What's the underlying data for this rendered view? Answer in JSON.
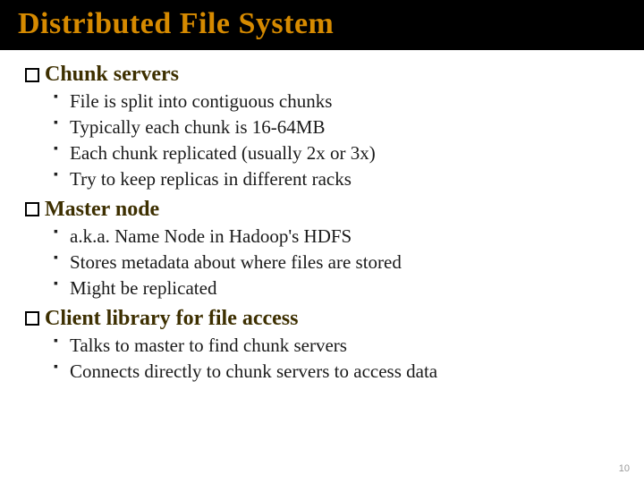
{
  "title": "Distributed File System",
  "sections": [
    {
      "heading": "Chunk servers",
      "items": [
        "File is split into contiguous chunks",
        "Typically each chunk is 16-64MB",
        "Each chunk replicated (usually 2x or 3x)",
        "Try to keep replicas in different racks"
      ]
    },
    {
      "heading": "Master node",
      "items": [
        "a.k.a. Name Node in Hadoop's HDFS",
        "Stores metadata about where files are stored",
        "Might be replicated"
      ]
    },
    {
      "heading": "Client library for file access",
      "items": [
        "Talks to master to find chunk servers",
        "Connects directly to chunk servers to access data"
      ]
    }
  ],
  "page_number": "10"
}
